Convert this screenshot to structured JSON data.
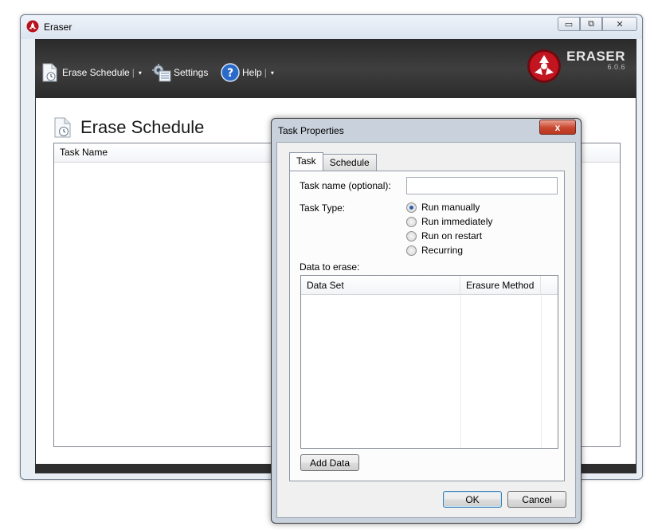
{
  "window": {
    "title": "Eraser",
    "minimize_glyph": "▭",
    "restore_glyph": "⧉",
    "close_glyph": "✕"
  },
  "toolbar": {
    "erase_schedule_label": "Erase Schedule",
    "settings_label": "Settings",
    "help_label": "Help",
    "separator": "|",
    "dropdown_glyph": "▾"
  },
  "logo": {
    "name": "ERASER",
    "version": "6.0.6"
  },
  "main": {
    "page_title": "Erase Schedule",
    "list_columns": [
      "Task Name"
    ]
  },
  "dialog": {
    "title": "Task Properties",
    "close_glyph": "x",
    "tabs": [
      {
        "label": "Task",
        "active": true
      },
      {
        "label": "Schedule",
        "active": false
      }
    ],
    "task_name_label": "Task name (optional):",
    "task_name_value": "",
    "task_type_label": "Task Type:",
    "task_types": [
      {
        "label": "Run manually",
        "checked": true
      },
      {
        "label": "Run immediately",
        "checked": false
      },
      {
        "label": "Run on restart",
        "checked": false
      },
      {
        "label": "Recurring",
        "checked": false
      }
    ],
    "data_to_erase_label": "Data to erase:",
    "data_columns": [
      "Data Set",
      "Erasure Method"
    ],
    "add_data_label": "Add Data",
    "ok_label": "OK",
    "cancel_label": "Cancel"
  },
  "colors": {
    "toolbar_bg": "#2e2e2e",
    "accent_blue": "#2a5ea8",
    "close_red": "#c8462f"
  }
}
